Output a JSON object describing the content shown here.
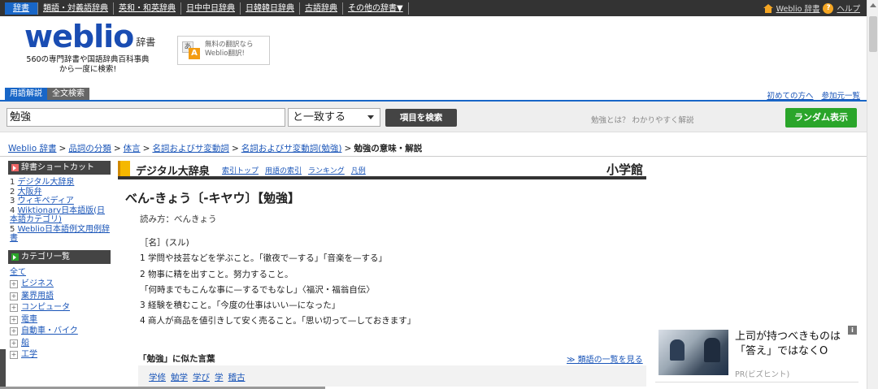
{
  "topnav": {
    "tabs": [
      "辞書",
      "類語・対義語辞典",
      "英和・和英辞典",
      "日中中日辞典",
      "日韓韓日辞典",
      "古語辞典",
      "その他の辞書▼"
    ],
    "home_label": "Weblio 辞書",
    "help_label": "ヘルプ"
  },
  "header": {
    "logo_word": "weblio",
    "logo_sub": "辞書",
    "tagline_1": "560の専門辞書や国語辞典百科事典",
    "tagline_2": "から一度に検索!",
    "translate_line1": "無料の翻訳なら",
    "translate_line2": "Weblio翻訳!"
  },
  "search": {
    "tabs": [
      "用語解説",
      "全文検索"
    ],
    "query": "勉強",
    "mode": "と一致する",
    "button": "項目を検索",
    "hint": "勉強とは？ わかりやすく解説",
    "random": "ランダム表示",
    "links": [
      "初めての方へ",
      "参加元一覧"
    ]
  },
  "breadcrumb": {
    "items": [
      "Weblio 辞書",
      "品詞の分類",
      "体言",
      "名詞およびサ変動詞",
      "名詞およびサ変動詞(勉強)"
    ],
    "current": "勉強の意味・解説"
  },
  "sidebar": {
    "shortcut_title": "辞書ショートカット",
    "shortcuts": [
      {
        "num": "1",
        "label": "デジタル大辞泉"
      },
      {
        "num": "2",
        "label": "大阪弁"
      },
      {
        "num": "3",
        "label": "ウィキペディア"
      },
      {
        "num": "4",
        "label": "Wiktionary日本語版(日本語カテゴリ)"
      },
      {
        "num": "5",
        "label": "Weblio日本語例文用例辞書"
      }
    ],
    "category_title": "カテゴリ一覧",
    "all_label": "全て",
    "categories": [
      "ビジネス",
      "業界用語",
      "コンピュータ",
      "電車",
      "自動車・バイク",
      "船",
      "工学"
    ]
  },
  "dict": {
    "name": "デジタル大辞泉",
    "links": [
      "索引トップ",
      "用語の索引",
      "ランキング",
      "凡例"
    ],
    "publisher": "小学館",
    "headword": "べん‐きょう〔‐キヤウ〕【勉強】",
    "reading": "読み方：べんきょう",
    "defs": [
      "［名］(スル)",
      "1 学問や技芸などを学ぶこと。「徹夜で—する」「音楽を—する」",
      "2 物事に精を出すこと。努力すること。",
      "「何時までもこんな事に—するでもなし」〈福沢・福翁自伝〉",
      "3 経験を積むこと。「今度の仕事はいい—になった」",
      "4 商人が商品を値引きして安く売ること。「思い切って—しておきます」"
    ],
    "similar_title": "「勉強」に似た言葉",
    "similar_more": "≫ 類語の一覧を見る",
    "similar_words": [
      "学修",
      "勉学",
      "学び",
      "学",
      "稽古"
    ]
  },
  "ad": {
    "title": "上司が持つべきものは「答え」ではなくO",
    "pr": "PR(ビズヒント)",
    "info": "i"
  }
}
